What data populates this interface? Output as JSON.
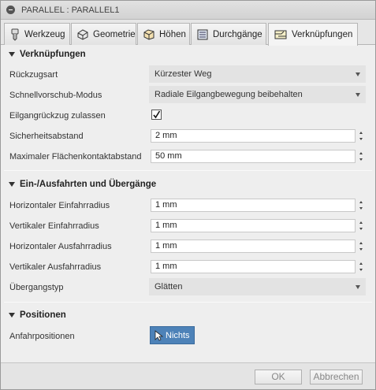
{
  "window": {
    "title": "PARALLEL : PARALLEL1"
  },
  "tabs": [
    {
      "label": "Werkzeug",
      "icon": "tool-icon"
    },
    {
      "label": "Geometrie",
      "icon": "geometry-icon"
    },
    {
      "label": "Höhen",
      "icon": "heights-icon"
    },
    {
      "label": "Durchgänge",
      "icon": "passes-icon"
    },
    {
      "label": "Verknüpfungen",
      "icon": "linking-icon",
      "active": true
    }
  ],
  "sections": {
    "linking": {
      "title": "Verknüpfungen",
      "retract_label": "Rückzugsart",
      "retract_value": "Kürzester Weg",
      "rapid_label": "Schnellvorschub-Modus",
      "rapid_value": "Radiale Eilgangbewegung beibehalten",
      "rampretract_label": "Eilgangrückzug zulassen",
      "rampretract_checked": true,
      "safe_label": "Sicherheitsabstand",
      "safe_value": "2 mm",
      "maxcontact_label": "Maximaler Flächenkontaktabstand",
      "maxcontact_value": "50 mm"
    },
    "leads": {
      "title": "Ein-/Ausfahrten und Übergänge",
      "h_entry_label": "Horizontaler Einfahrradius",
      "h_entry_value": "1 mm",
      "v_entry_label": "Vertikaler Einfahrradius",
      "v_entry_value": "1 mm",
      "h_exit_label": "Horizontaler Ausfahrradius",
      "h_exit_value": "1 mm",
      "v_exit_label": "Vertikaler Ausfahrradius",
      "v_exit_value": "1 mm",
      "transition_label": "Übergangstyp",
      "transition_value": "Glätten"
    },
    "positions": {
      "title": "Positionen",
      "approach_label": "Anfahrpositionen",
      "approach_button": "Nichts"
    }
  },
  "footer": {
    "ok_label": "OK",
    "cancel_label": "Abbrechen"
  },
  "colors": {
    "accent": "#4d82b8",
    "panel": "#eeeeee"
  }
}
